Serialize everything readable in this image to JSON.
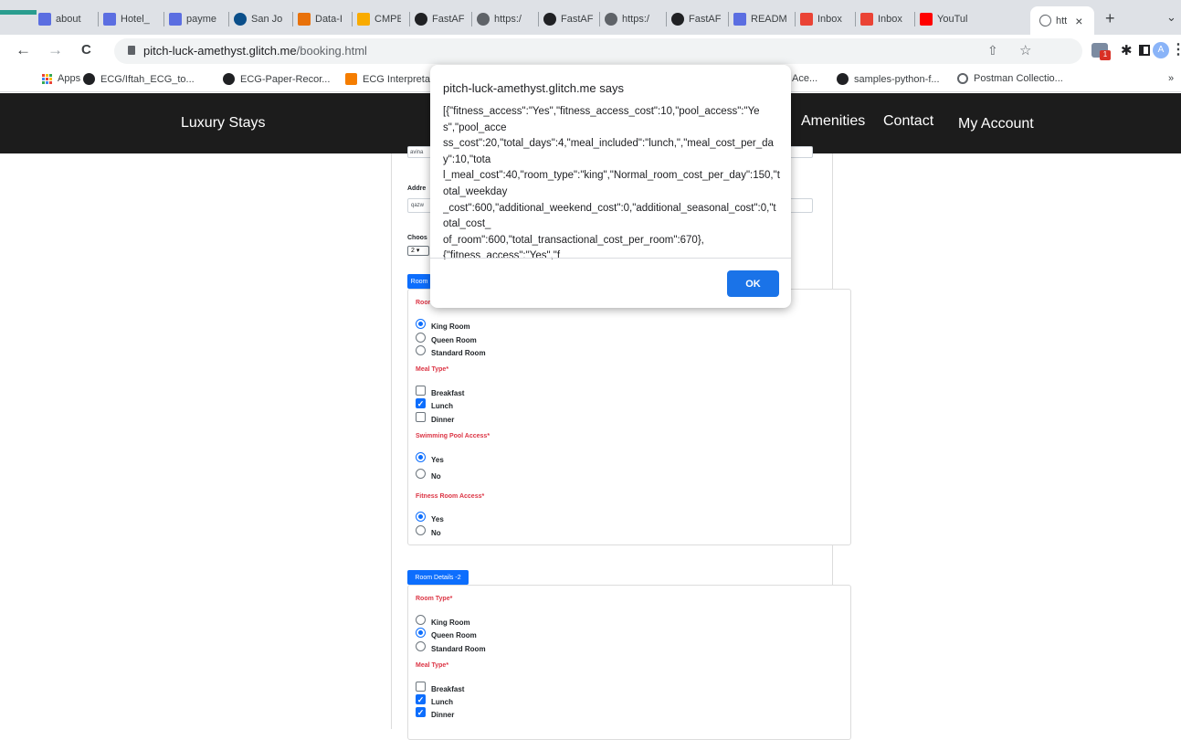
{
  "tabs": [
    {
      "label": "about",
      "icon": "hotel-favicon",
      "color": "#5b6ee1"
    },
    {
      "label": "Hotel_",
      "icon": "hotel-favicon",
      "color": "#5b6ee1"
    },
    {
      "label": "payme",
      "icon": "hotel-favicon",
      "color": "#5b6ee1"
    },
    {
      "label": "San Jo",
      "icon": "circle-favicon",
      "color": "#0b4f8a"
    },
    {
      "label": "Data-I",
      "icon": "data-favicon",
      "color": "#e8710a"
    },
    {
      "label": "CMPE",
      "icon": "cmpe-favicon",
      "color": "#f9ab00"
    },
    {
      "label": "FastAF",
      "icon": "fastapi-favicon",
      "color": "#202124"
    },
    {
      "label": "https:/",
      "icon": "globe-favicon",
      "color": "#5f6368"
    },
    {
      "label": "FastAF",
      "icon": "fastapi-favicon",
      "color": "#202124"
    },
    {
      "label": "https:/",
      "icon": "globe-favicon",
      "color": "#5f6368"
    },
    {
      "label": "FastAF",
      "icon": "fastapi-favicon",
      "color": "#202124"
    },
    {
      "label": "READM",
      "icon": "hotel-favicon",
      "color": "#5b6ee1"
    },
    {
      "label": "Inbox",
      "icon": "gmail-favicon",
      "color": "#ea4335"
    },
    {
      "label": "Inbox",
      "icon": "gmail-favicon",
      "color": "#ea4335"
    },
    {
      "label": "YouTul",
      "icon": "youtube-favicon",
      "color": "#ff0000"
    }
  ],
  "active_tab": {
    "label": "htt",
    "close": "×"
  },
  "new_tab": "+",
  "tab_overflow": "⌄",
  "address": {
    "host": "pitch-luck-amethyst.glitch.me",
    "path": "/booking.html"
  },
  "toolbar_icons": {
    "back": "←",
    "forward": "→",
    "reload": "C",
    "share": "⇧",
    "star": "☆",
    "puzzle": "✱",
    "sidepanel": "□",
    "profile": "A",
    "menu": "⋮"
  },
  "extension_badge": "1",
  "bookmarks": [
    {
      "label": "Apps",
      "icon": "apps-grid-icon"
    },
    {
      "label": "ECG/Iftah_ECG_to...",
      "icon": "github-icon"
    },
    {
      "label": "ECG-Paper-Recor...",
      "icon": "github-icon"
    },
    {
      "label": "ECG Interpreta",
      "icon": "blogger-icon"
    },
    {
      "label": "Ace...",
      "icon": ""
    },
    {
      "label": "samples-python-f...",
      "icon": "github-icon"
    },
    {
      "label": "Postman Collectio...",
      "icon": "postman-icon"
    }
  ],
  "bookmarks_more": "»",
  "navbar": {
    "brand": "Luxury Stays",
    "links": [
      "Amenities",
      "Contact",
      "My Account"
    ]
  },
  "form": {
    "email_value": "avina",
    "address_label": "Addre",
    "address_value": "qazw",
    "choose_label": "Choos",
    "rooms_select": "2",
    "room1": {
      "badge": "Room",
      "room_type_label": "Roor",
      "room_types": [
        {
          "label": "King Room",
          "checked": true
        },
        {
          "label": "Queen Room",
          "checked": false
        },
        {
          "label": "Standard Room",
          "checked": false
        }
      ],
      "meal_label": "Meal Type*",
      "meals": [
        {
          "label": "Breakfast",
          "checked": false
        },
        {
          "label": "Lunch",
          "checked": true
        },
        {
          "label": "Dinner",
          "checked": false
        }
      ],
      "pool_label": "Swimming Pool Access*",
      "pool": [
        {
          "label": "Yes",
          "checked": true
        },
        {
          "label": "No",
          "checked": false
        }
      ],
      "fitness_label": "Fitness Room Access*",
      "fitness": [
        {
          "label": "Yes",
          "checked": true
        },
        {
          "label": "No",
          "checked": false
        }
      ]
    },
    "room2": {
      "badge": "Room Details -2",
      "room_type_label": "Room Type*",
      "room_types": [
        {
          "label": "King Room",
          "checked": false
        },
        {
          "label": "Queen Room",
          "checked": true
        },
        {
          "label": "Standard Room",
          "checked": false
        }
      ],
      "meal_label": "Meal Type*",
      "meals": [
        {
          "label": "Breakfast",
          "checked": false
        },
        {
          "label": "Lunch",
          "checked": true
        },
        {
          "label": "Dinner",
          "checked": true
        }
      ]
    }
  },
  "dialog": {
    "title": "pitch-luck-amethyst.glitch.me says",
    "message": "[{\"fitness_access\":\"Yes\",\"fitness_access_cost\":10,\"pool_access\":\"Yes\",\"pool_acce\nss_cost\":20,\"total_days\":4,\"meal_included\":\"lunch,\",\"meal_cost_per_day\":10,\"tota\nl_meal_cost\":40,\"room_type\":\"king\",\"Normal_room_cost_per_day\":150,\"total_weekday\n_cost\":600,\"additional_weekend_cost\":0,\"additional_seasonal_cost\":0,\"total_cost_\nof_room\":600,\"total_transactional_cost_per_room\":670},\n{\"fitness_access\":\"Yes\",\"f",
    "ok": "OK"
  },
  "colors": {
    "primary": "#0d6efd",
    "required_red": "#dc3545",
    "navbar": "#1c1c1c",
    "dialog_button": "#1a73e8"
  }
}
